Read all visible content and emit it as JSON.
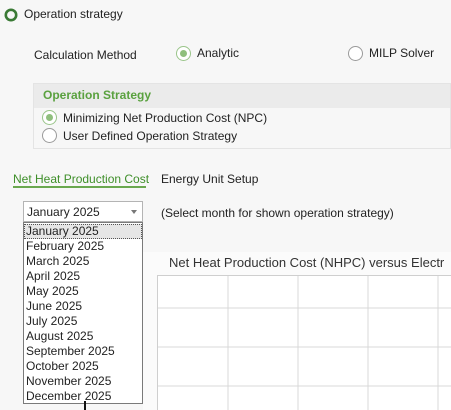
{
  "window": {
    "title": "Operation strategy"
  },
  "calculation": {
    "label": "Calculation Method",
    "options": [
      {
        "label": "Analytic",
        "checked": true
      },
      {
        "label": "MILP Solver",
        "checked": false
      }
    ]
  },
  "strategy": {
    "title": "Operation Strategy",
    "options": [
      {
        "label": "Minimizing Net Production Cost (NPC)",
        "checked": true
      },
      {
        "label": "User Defined Operation Strategy",
        "checked": false
      }
    ]
  },
  "tabs": [
    {
      "label": "Net Heat Production Cost",
      "active": true
    },
    {
      "label": "Energy Unit Setup",
      "active": false
    }
  ],
  "month_select": {
    "value": "January 2025",
    "hint": "(Select month for shown operation strategy)",
    "options": [
      "January 2025",
      "February 2025",
      "March 2025",
      "April 2025",
      "May 2025",
      "June 2025",
      "July 2025",
      "August 2025",
      "September 2025",
      "October 2025",
      "November 2025",
      "December 2025"
    ]
  },
  "chart": {
    "title": "Net Heat Production Cost (NHPC) versus Electr"
  },
  "colors": {
    "accent": "#5aa13f",
    "tab_underline": "#6aa84f"
  },
  "icons": {
    "app": "app-ring-icon",
    "dropdown_arrow": "chevron-down-icon"
  }
}
